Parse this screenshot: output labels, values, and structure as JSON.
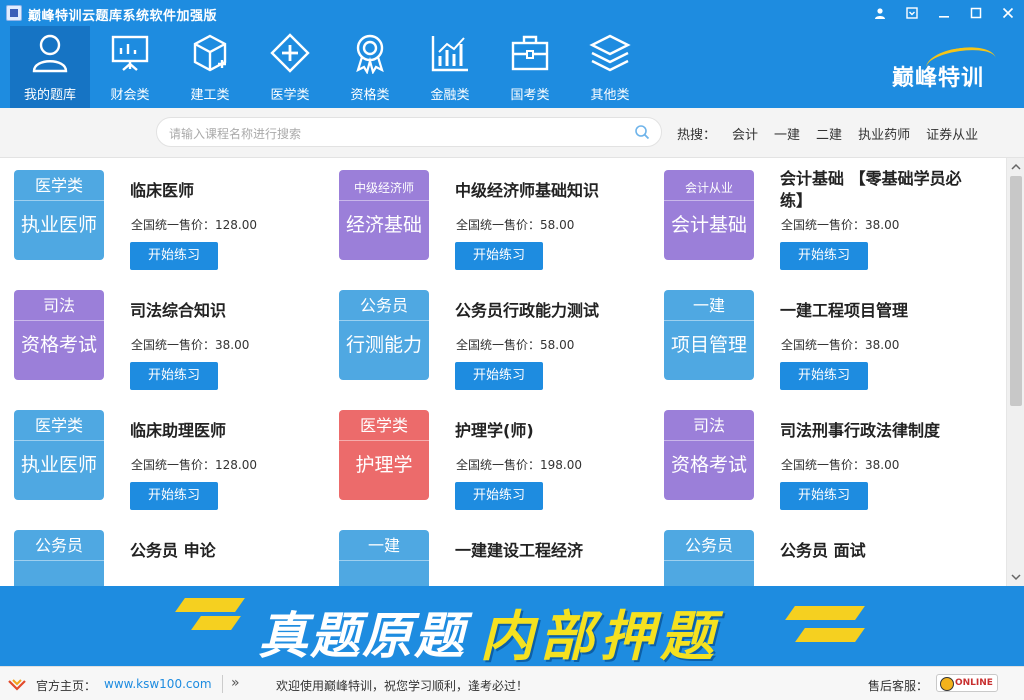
{
  "window": {
    "title": "巅峰特训云题库系统软件加强版"
  },
  "nav": {
    "items": [
      {
        "label": "我的题库",
        "icon": "user-icon"
      },
      {
        "label": "财会类",
        "icon": "chart-board-icon"
      },
      {
        "label": "建工类",
        "icon": "cube-icon"
      },
      {
        "label": "医学类",
        "icon": "medical-cross-icon"
      },
      {
        "label": "资格类",
        "icon": "award-medal-icon"
      },
      {
        "label": "金融类",
        "icon": "bar-chart-icon"
      },
      {
        "label": "国考类",
        "icon": "briefcase-icon"
      },
      {
        "label": "其他类",
        "icon": "layers-icon"
      }
    ],
    "logo": "巅峰特训"
  },
  "search": {
    "placeholder": "请输入课程名称进行搜索",
    "hot_label": "热搜：",
    "hot": [
      "会计",
      "一建",
      "二建",
      "执业药师",
      "证券从业"
    ]
  },
  "cards": [
    {
      "badge_top": "医学类",
      "badge_bottom": "执业医师",
      "color": "blue",
      "title": "临床医师",
      "price": "全国统一售价：128.00",
      "button": "开始练习"
    },
    {
      "badge_top": "中级经济师",
      "badge_bottom": "经济基础",
      "color": "purple",
      "title": "中级经济师基础知识",
      "price": "全国统一售价：58.00",
      "button": "开始练习"
    },
    {
      "badge_top": "会计从业",
      "badge_bottom": "会计基础",
      "color": "purple",
      "title": "会计基础 【零基础学员必练】",
      "price": "全国统一售价：38.00",
      "button": "开始练习"
    },
    {
      "badge_top": "司法",
      "badge_bottom": "资格考试",
      "color": "purple",
      "title": "司法综合知识",
      "price": "全国统一售价：38.00",
      "button": "开始练习"
    },
    {
      "badge_top": "公务员",
      "badge_bottom": "行测能力",
      "color": "blue",
      "title": "公务员行政能力测试",
      "price": "全国统一售价：58.00",
      "button": "开始练习"
    },
    {
      "badge_top": "一建",
      "badge_bottom": "项目管理",
      "color": "blue",
      "title": "一建工程项目管理",
      "price": "全国统一售价：38.00",
      "button": "开始练习"
    },
    {
      "badge_top": "医学类",
      "badge_bottom": "执业医师",
      "color": "blue",
      "title": "临床助理医师",
      "price": "全国统一售价：128.00",
      "button": "开始练习"
    },
    {
      "badge_top": "医学类",
      "badge_bottom": "护理学",
      "color": "red",
      "title": "护理学(师)",
      "price": "全国统一售价：198.00",
      "button": "开始练习"
    },
    {
      "badge_top": "司法",
      "badge_bottom": "资格考试",
      "color": "purple",
      "title": "司法刑事行政法律制度",
      "price": "全国统一售价：38.00",
      "button": "开始练习"
    },
    {
      "badge_top": "公务员",
      "badge_bottom": "",
      "color": "blue",
      "title": "公务员 申论",
      "price": "",
      "button": ""
    },
    {
      "badge_top": "一建",
      "badge_bottom": "",
      "color": "blue",
      "title": "一建建设工程经济",
      "price": "",
      "button": ""
    },
    {
      "badge_top": "公务员",
      "badge_bottom": "",
      "color": "blue",
      "title": "公务员 面试",
      "price": "",
      "button": ""
    }
  ],
  "banner": {
    "text_white": "真题原题",
    "text_yellow": "内部押题"
  },
  "status": {
    "home_label": "官方主页：",
    "url": "www.ksw100.com",
    "chevron": "»",
    "welcome": "欢迎使用巅峰特训，祝您学习顺利，逢考必过！",
    "service_label": "售后客服：",
    "online": "ONLINE"
  },
  "colors": {
    "primary": "#1e8ce0",
    "nav_active": "#1674c4",
    "badge_blue": "#4fa8e2",
    "badge_purple": "#9b7fd9",
    "badge_red": "#ec6b6b",
    "banner_yellow": "#f5e120"
  }
}
